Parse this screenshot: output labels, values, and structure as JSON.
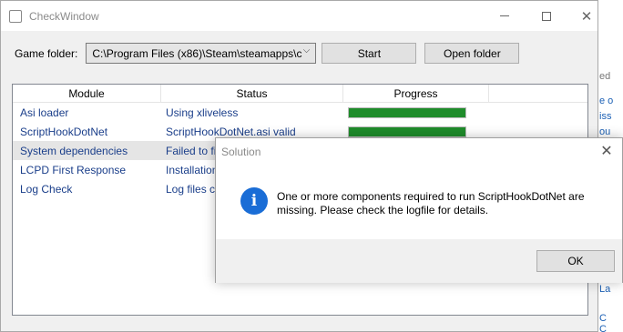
{
  "window": {
    "title": "CheckWindow",
    "game_folder_label": "Game folder:",
    "game_folder_value": "C:\\Program Files (x86)\\Steam\\steamapps\\c",
    "start_label": "Start",
    "open_folder_label": "Open folder"
  },
  "list": {
    "columns": [
      "Module",
      "Status",
      "Progress"
    ],
    "rows": [
      {
        "module": "Asi loader",
        "status": "Using xliveless",
        "progress": 1.0
      },
      {
        "module": "ScriptHookDotNet",
        "status": "ScriptHookDotNet.asi valid",
        "progress": 1.0
      },
      {
        "module": "System dependencies",
        "status": "Failed to fin",
        "progress": null
      },
      {
        "module": "LCPD First Response",
        "status": "Installation",
        "progress": null
      },
      {
        "module": "Log Check",
        "status": "Log files ch",
        "progress": null
      }
    ]
  },
  "dialog": {
    "title": "Solution",
    "message": "One or more components required to run ScriptHookDotNet are missing. Please check the logfile for details.",
    "ok_label": "OK"
  },
  "background_fragments": [
    "ed",
    "e o",
    "iss",
    "ou",
    "La",
    "C",
    "C"
  ],
  "colors": {
    "progress_fill": "#1f8c2b",
    "info_icon": "#1a6dd6",
    "list_text": "#1a3e8a"
  }
}
